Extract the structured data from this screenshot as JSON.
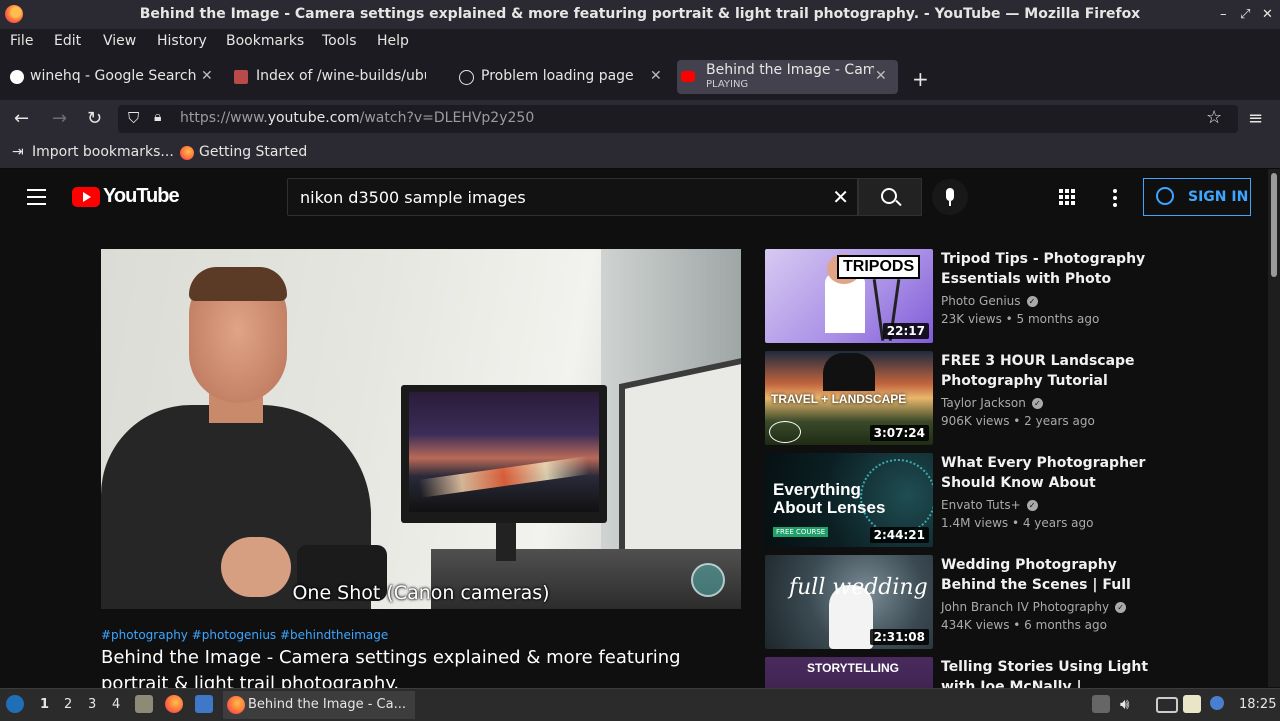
{
  "window": {
    "title": "Behind the Image - Camera settings explained & more featuring portrait & light trail photography. - YouTube — Mozilla Firefox",
    "controls": [
      "–",
      "⤢",
      "✕"
    ]
  },
  "menubar": [
    "File",
    "Edit",
    "View",
    "History",
    "Bookmarks",
    "Tools",
    "Help"
  ],
  "tabs": [
    {
      "label": "winehq - Google Search"
    },
    {
      "label": "Index of /wine-builds/ubu"
    },
    {
      "label": "Problem loading page"
    },
    {
      "label": "Behind the Image - Came",
      "sub": "PLAYING"
    }
  ],
  "tab_new": "+",
  "nav": {
    "url_prefix": "https://www.",
    "url_host": "youtube.com",
    "url_path": "/watch?v=DLEHVp2y250"
  },
  "bookmarks": [
    "Import bookmarks...",
    "Getting Started"
  ],
  "youtube": {
    "logo_text": "YouTube",
    "search_value": "nikon d3500 sample images",
    "sign_in": "SIGN IN"
  },
  "player": {
    "caption": "One Shot (Canon cameras)"
  },
  "video": {
    "hashtags": "#photography #photogenius #behindtheimage",
    "title": "Behind the Image - Camera settings explained & more featuring portrait & light trail photography."
  },
  "suggestions": [
    {
      "title": "Tripod Tips - Photography Essentials with Photo Genius",
      "channel": "Photo Genius",
      "meta": "23K views • 5 months ago",
      "duration": "22:17",
      "thumb_text": "TRIPODS"
    },
    {
      "title": "FREE 3 HOUR Landscape Photography Tutorial WITH…",
      "channel": "Taylor Jackson",
      "meta": "906K views • 2 years ago",
      "duration": "3:07:24",
      "thumb_text": "TRAVEL + LANDSCAPE"
    },
    {
      "title": "What Every Photographer Should Know About Lenses",
      "channel": "Envato Tuts+",
      "meta": "1.4M views • 4 years ago",
      "duration": "2:44:21",
      "thumb_text": "Everything About Lenses"
    },
    {
      "title": "Wedding Photography Behind the Scenes | Full Wedding Day …",
      "channel": "John Branch IV Photography",
      "meta": "434K views • 6 months ago",
      "duration": "2:31:08",
      "thumb_text": "full wedding"
    },
    {
      "title": "Telling Stories Using Light with Joe McNally | Portrait…",
      "channel": "",
      "meta": "",
      "duration": "",
      "thumb_text": "STORYTELLING"
    }
  ],
  "taskbar": {
    "workspaces": [
      "1",
      "2",
      "3",
      "4"
    ],
    "task_label": "Behind the Image - Ca...",
    "clock": "18:25"
  }
}
